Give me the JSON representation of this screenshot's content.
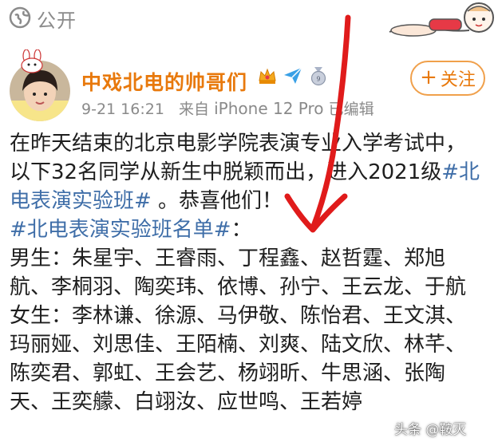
{
  "topbar": {
    "visibility": "公开"
  },
  "post": {
    "username": "中戏北电的帅哥们",
    "meta": {
      "timestamp": "9-21 16:21",
      "source_prefix": "来自",
      "device": "iPhone 12 Pro",
      "edited": "已编辑"
    },
    "follow_label": "关注",
    "lines": [
      [
        "在昨天结束的北京电影学院表演专业入学考试中，",
        ""
      ],
      [
        "以下32名同学从新生中脱颖而出，进入2021级",
        "#北"
      ],
      [
        "",
        "电表演实验班#",
        " 。恭喜他们！"
      ],
      [
        "",
        "#北电表演实验班名单#",
        "："
      ],
      [
        "男生：朱星宇、王睿雨、丁程鑫、赵哲霆、郑旭"
      ],
      [
        "航、李桐羽、陶奕玮、依博、孙宁、王云龙、于航"
      ],
      [
        "女生：李林谦、徐源、马伊敬、陈怡君、王文淇、"
      ],
      [
        "玛丽娅、刘思佳、王陌楠、刘爽、陆文欣、林芊、"
      ],
      [
        "陈奕君、郭虹、王会艺、杨翊昕、牛思涵、张陶"
      ],
      [
        "天、王奕艨、白翊汝、应世鸣、王若婷"
      ]
    ]
  },
  "watermark": "头条 @鞍灭",
  "colors": {
    "accent": "#e8790c",
    "hashtag": "#3f6ea8",
    "arrow": "#e01b1b"
  }
}
